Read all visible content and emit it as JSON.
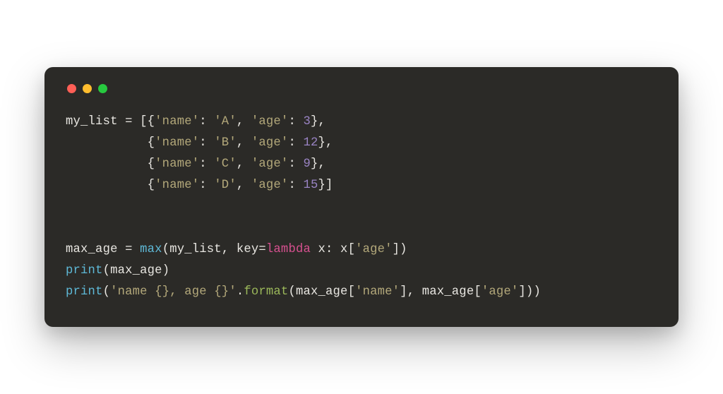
{
  "code": {
    "line1": {
      "t1": "my_list = [{",
      "s1": "'name'",
      "t2": ": ",
      "s2": "'A'",
      "t3": ", ",
      "s3": "'age'",
      "t4": ": ",
      "n1": "3",
      "t5": "},"
    },
    "line2": {
      "t1": "           {",
      "s1": "'name'",
      "t2": ": ",
      "s2": "'B'",
      "t3": ", ",
      "s3": "'age'",
      "t4": ": ",
      "n1": "12",
      "t5": "},"
    },
    "line3": {
      "t1": "           {",
      "s1": "'name'",
      "t2": ": ",
      "s2": "'C'",
      "t3": ", ",
      "s3": "'age'",
      "t4": ": ",
      "n1": "9",
      "t5": "},"
    },
    "line4": {
      "t1": "           {",
      "s1": "'name'",
      "t2": ": ",
      "s2": "'D'",
      "t3": ", ",
      "s3": "'age'",
      "t4": ": ",
      "n1": "15",
      "t5": "}]"
    },
    "blank": "",
    "line5": {
      "t1": "max_age = ",
      "f1": "max",
      "t2": "(my_list, key=",
      "k1": "lambda",
      "t3": " x: x[",
      "s1": "'age'",
      "t4": "])"
    },
    "line6": {
      "f1": "print",
      "t1": "(max_age)"
    },
    "line7": {
      "f1": "print",
      "t1": "(",
      "s1": "'name {}, age {}'",
      "t2": ".",
      "m1": "format",
      "t3": "(max_age[",
      "s2": "'name'",
      "t4": "], max_age[",
      "s3": "'age'",
      "t5": "]))"
    }
  }
}
